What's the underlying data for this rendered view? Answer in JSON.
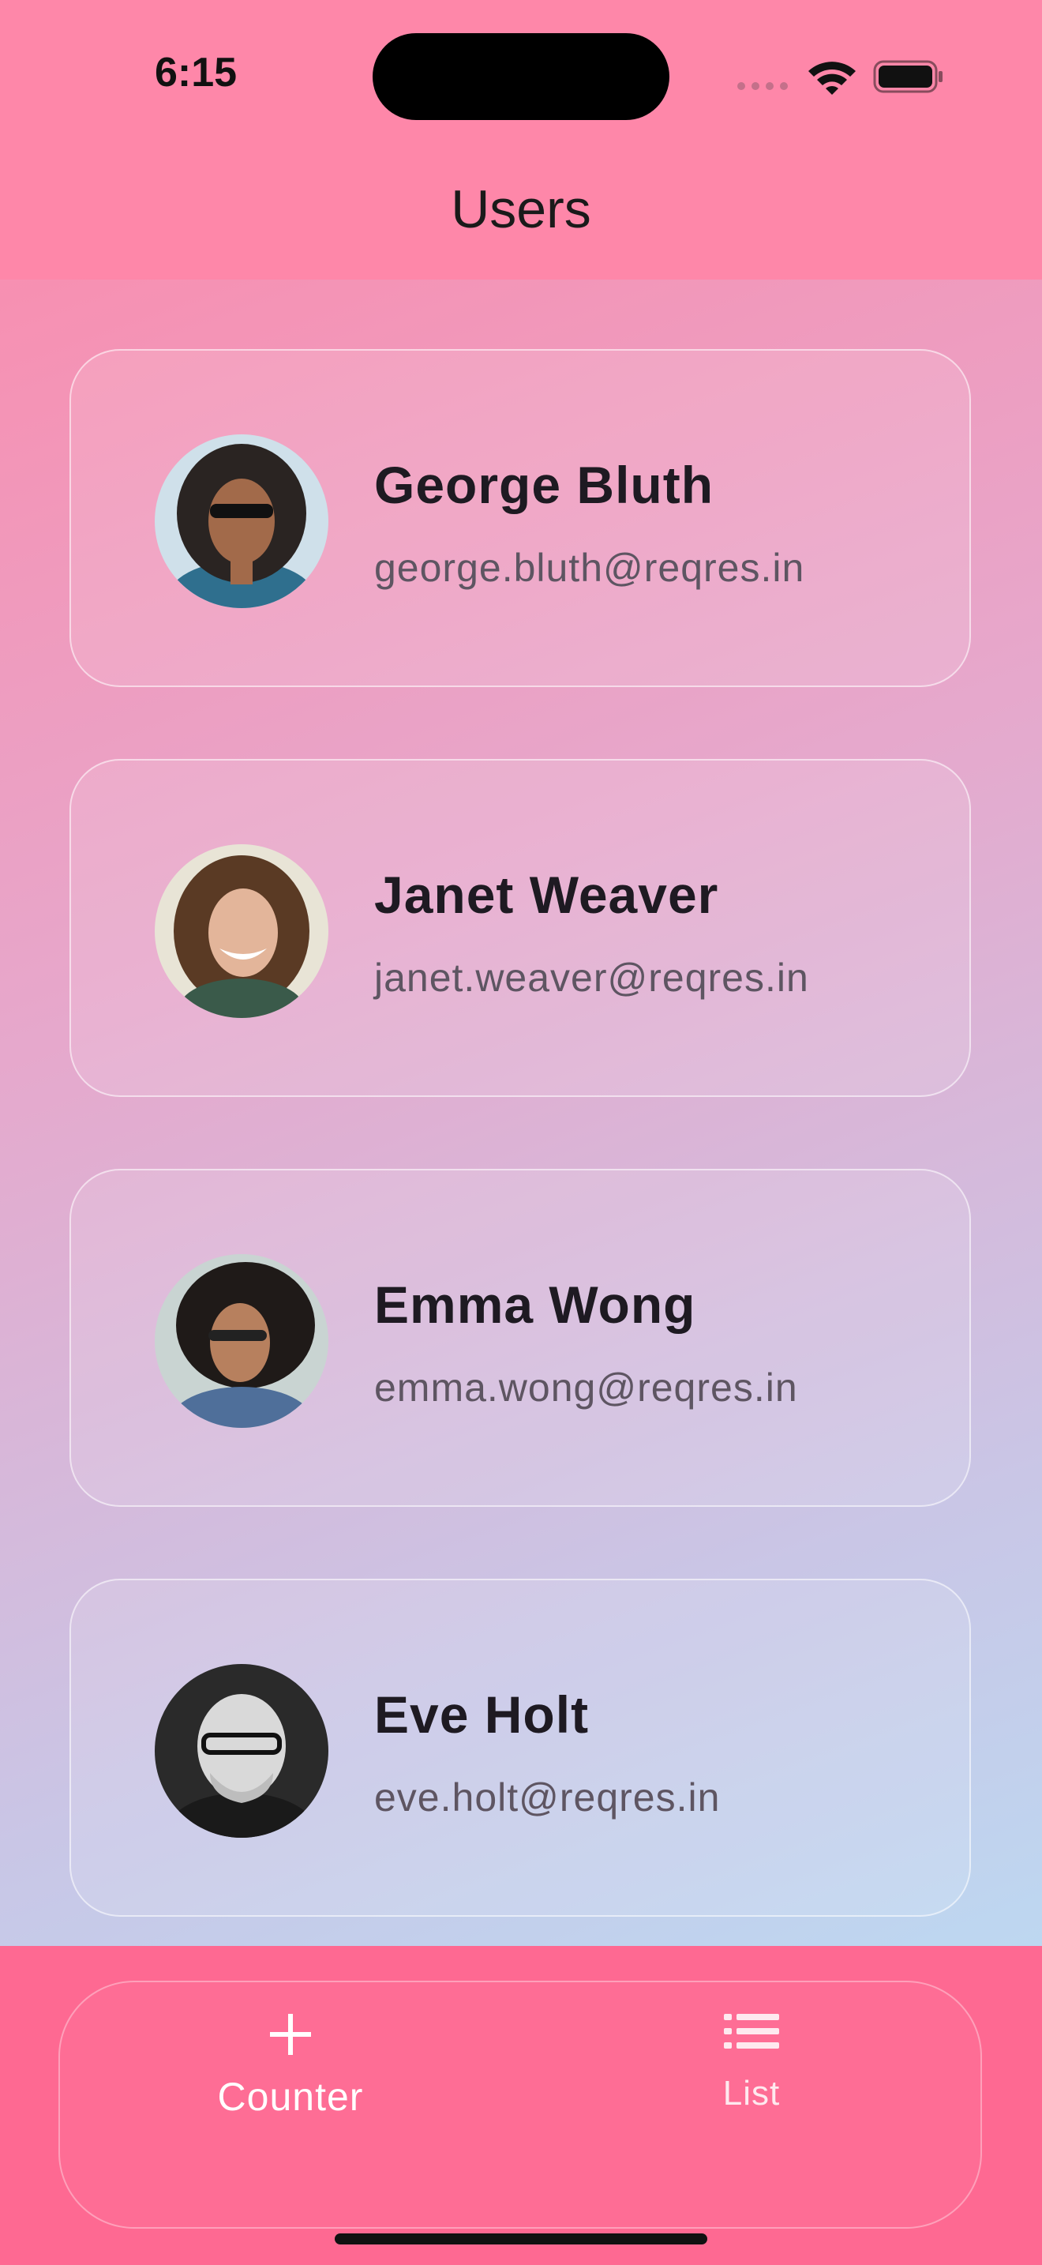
{
  "status_bar": {
    "time": "6:15"
  },
  "header": {
    "title": "Users"
  },
  "users": [
    {
      "name": "George Bluth",
      "email": "george.bluth@reqres.in"
    },
    {
      "name": "Janet Weaver",
      "email": "janet.weaver@reqres.in"
    },
    {
      "name": "Emma Wong",
      "email": "emma.wong@reqres.in"
    },
    {
      "name": "Eve Holt",
      "email": "eve.holt@reqres.in"
    }
  ],
  "bottom_nav": {
    "items": [
      {
        "label": "Counter",
        "icon": "plus-icon",
        "selected": true
      },
      {
        "label": "List",
        "icon": "list-icon",
        "selected": false
      }
    ]
  },
  "colors": {
    "app_bar": "#fe87a9",
    "bottom_bar": "#fe6992",
    "text_primary": "#1e1a22",
    "text_secondary": "#5e5562"
  }
}
